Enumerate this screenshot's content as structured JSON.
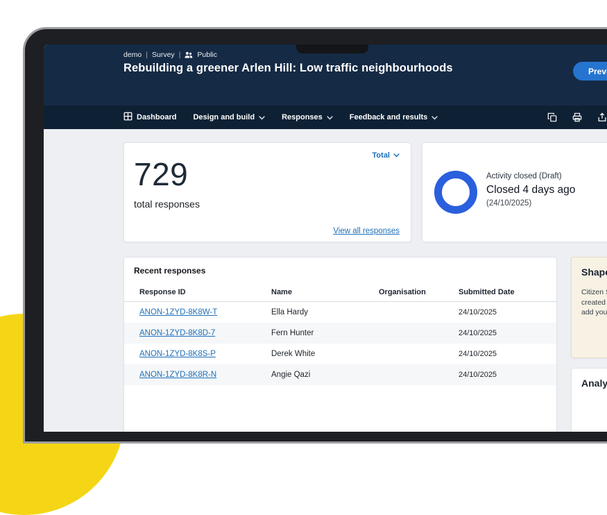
{
  "page": {
    "breadcrumb": {
      "project": "demo",
      "separator": "|",
      "type": "Survey",
      "visibility": "Public"
    },
    "title": "Rebuilding a greener Arlen Hill: Low traffic neighbourhoods",
    "preview_button": "Preview"
  },
  "nav": {
    "items": [
      {
        "label": "Dashboard"
      },
      {
        "label": "Design and build"
      },
      {
        "label": "Responses"
      },
      {
        "label": "Feedback and results"
      }
    ],
    "action_icons": [
      "copy-icon",
      "print-icon",
      "export-icon"
    ]
  },
  "stats_card": {
    "filter_label": "Total",
    "count": "729",
    "count_label": "total responses",
    "view_all_link": "View all responses"
  },
  "activity_card": {
    "status_line": "Activity closed (Draft)",
    "closed_line": "Closed 4 days ago",
    "date_line": "(24/10/2025)"
  },
  "recent_responses": {
    "title": "Recent responses",
    "columns": [
      "Response ID",
      "Name",
      "Organisation",
      "Submitted Date"
    ],
    "rows": [
      {
        "id": "ANON-1ZYD-8K8W-T",
        "name": "Ella Hardy",
        "organisation": "",
        "date": "24/10/2025"
      },
      {
        "id": "ANON-1ZYD-8K8D-7",
        "name": "Fern Hunter",
        "organisation": "",
        "date": "24/10/2025"
      },
      {
        "id": "ANON-1ZYD-8K8S-P",
        "name": "Derek White",
        "organisation": "",
        "date": "24/10/2025"
      },
      {
        "id": "ANON-1ZYD-8K8R-N",
        "name": "Angie Qazi",
        "organisation": "",
        "date": "24/10/2025"
      }
    ]
  },
  "shape_card": {
    "title": "Shape",
    "body_lines": [
      "Citizen S",
      "created",
      "add you"
    ]
  },
  "analyse_card": {
    "title": "Analyse"
  },
  "icons": {
    "nav_dashboard": "grid-icon",
    "breadcrumb_visibility": "people-icon",
    "dropdowns": "chevron-down-icon",
    "nav_actions": [
      "copy-icon",
      "print-icon",
      "export-icon"
    ]
  },
  "colors": {
    "header_navy": "#152a45",
    "navbar_navy": "#0e2134",
    "accent_blue": "#1d70b8",
    "ring_blue": "#2a5fdd",
    "page_bg": "#edeff3",
    "highlight_yellow": "#f4d616"
  }
}
